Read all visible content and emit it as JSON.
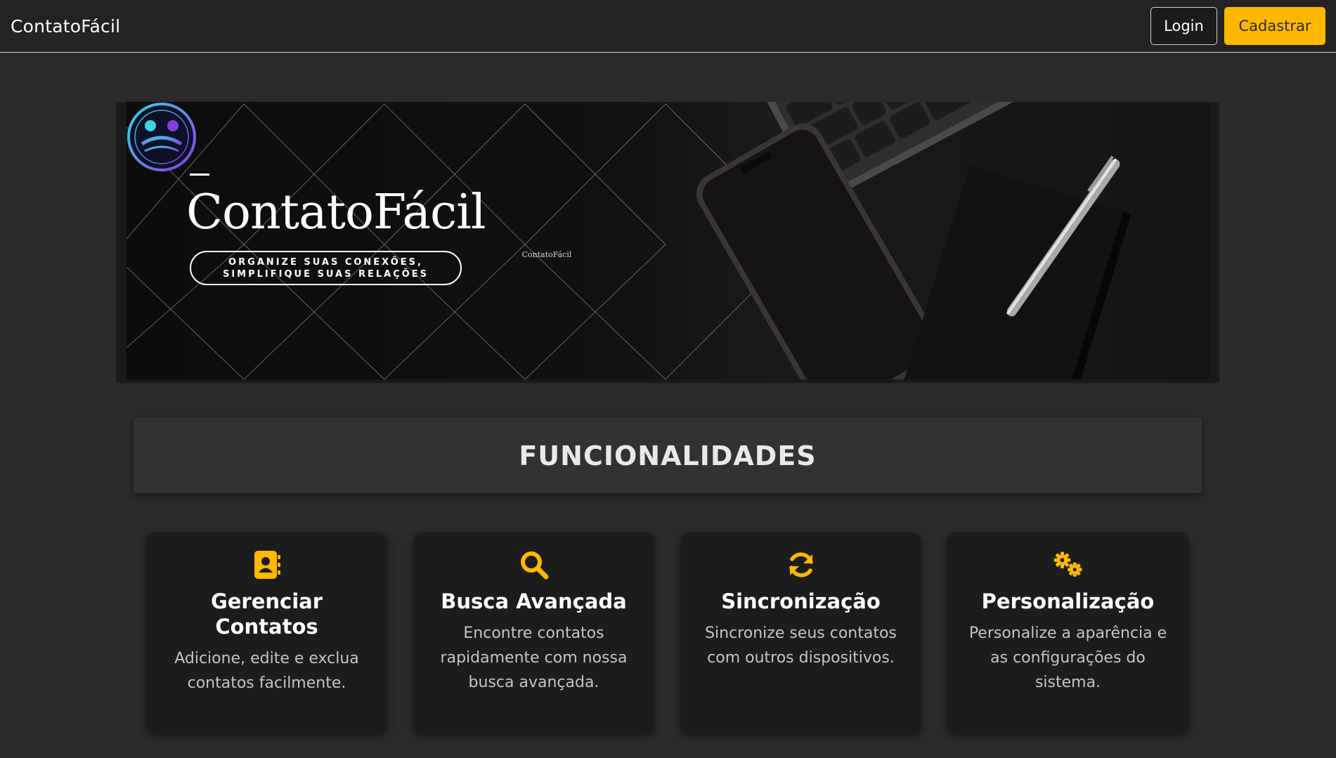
{
  "navbar": {
    "brand": "ContatoFácil",
    "login_label": "Login",
    "signup_label": "Cadastrar"
  },
  "banner": {
    "title": "ContatoFácil",
    "tagline_line1": "ORGANIZE SUAS CONEXÕES,",
    "tagline_line2": "SIMPLIFIQUE SUAS RELAÇÕES",
    "logo_caption": "ContatoFácil"
  },
  "section": {
    "title": "FUNCIONALIDADES"
  },
  "features": [
    {
      "icon": "address-book-icon",
      "title": "Gerenciar Contatos",
      "description": "Adicione, edite e exclua contatos facilmente."
    },
    {
      "icon": "search-icon",
      "title": "Busca Avançada",
      "description": "Encontre contatos rapidamente com nossa busca avançada."
    },
    {
      "icon": "sync-icon",
      "title": "Sincronização",
      "description": "Sincronize seus contatos com outros dispositivos."
    },
    {
      "icon": "cogs-icon",
      "title": "Personalização",
      "description": "Personalize a aparência e as configurações do sistema."
    }
  ],
  "colors": {
    "accent": "#ffb800",
    "background": "#2a2a2a",
    "card": "#1c1c1c"
  }
}
